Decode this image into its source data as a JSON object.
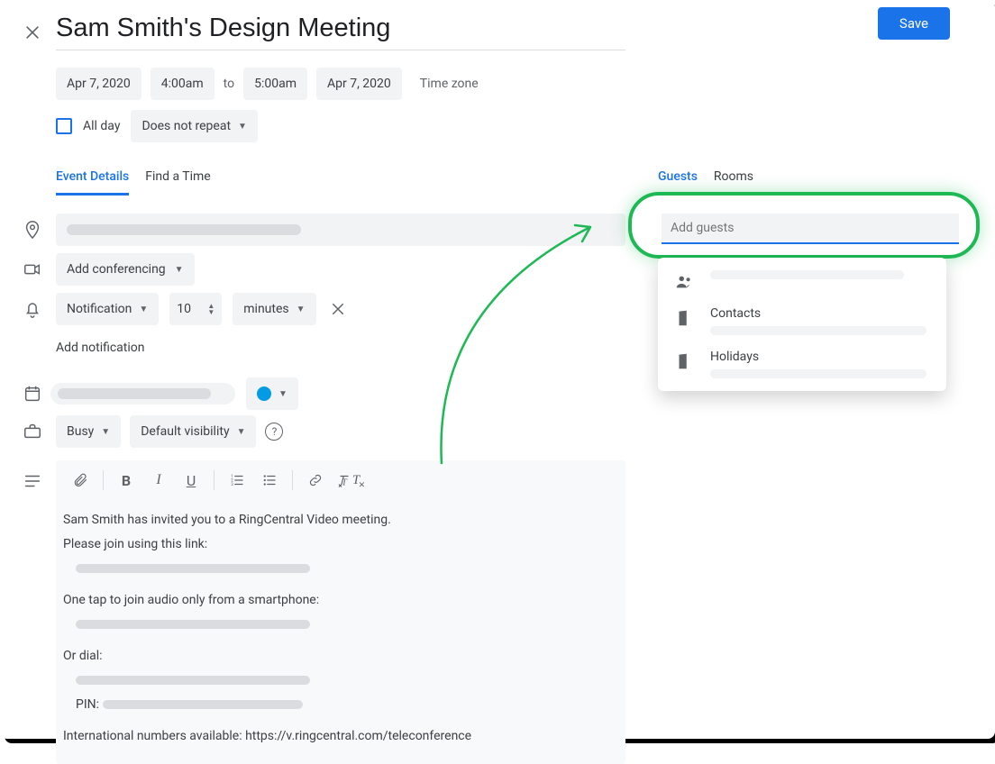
{
  "header": {
    "title": "Sam Smith's Design Meeting",
    "save_label": "Save"
  },
  "datetime": {
    "start_date": "Apr 7, 2020",
    "start_time": "4:00am",
    "to_label": "to",
    "end_time": "5:00am",
    "end_date": "Apr 7, 2020",
    "timezone_label": "Time zone"
  },
  "allday": {
    "label": "All day",
    "checked": false,
    "repeat_label": "Does not repeat"
  },
  "tabs_left": {
    "details": "Event Details",
    "find_time": "Find a Time"
  },
  "tabs_right": {
    "guests": "Guests",
    "rooms": "Rooms"
  },
  "conferencing": {
    "label": "Add conferencing"
  },
  "notification": {
    "type_label": "Notification",
    "amount": "10",
    "unit_label": "minutes"
  },
  "add_notification_label": "Add notification",
  "availability": {
    "busy_label": "Busy",
    "visibility_label": "Default visibility"
  },
  "description": {
    "line1": "Sam Smith has invited you to a RingCentral Video meeting.",
    "line2": "Please join using this link:",
    "line3": "One tap to join audio only from a smartphone:",
    "line4": "Or dial:",
    "pin_label": "PIN:",
    "intl_label": "International numbers available: https://v.ringcentral.com/teleconference"
  },
  "guests": {
    "placeholder": "Add guests",
    "suggestions": {
      "contacts": "Contacts",
      "holidays": "Holidays"
    }
  }
}
